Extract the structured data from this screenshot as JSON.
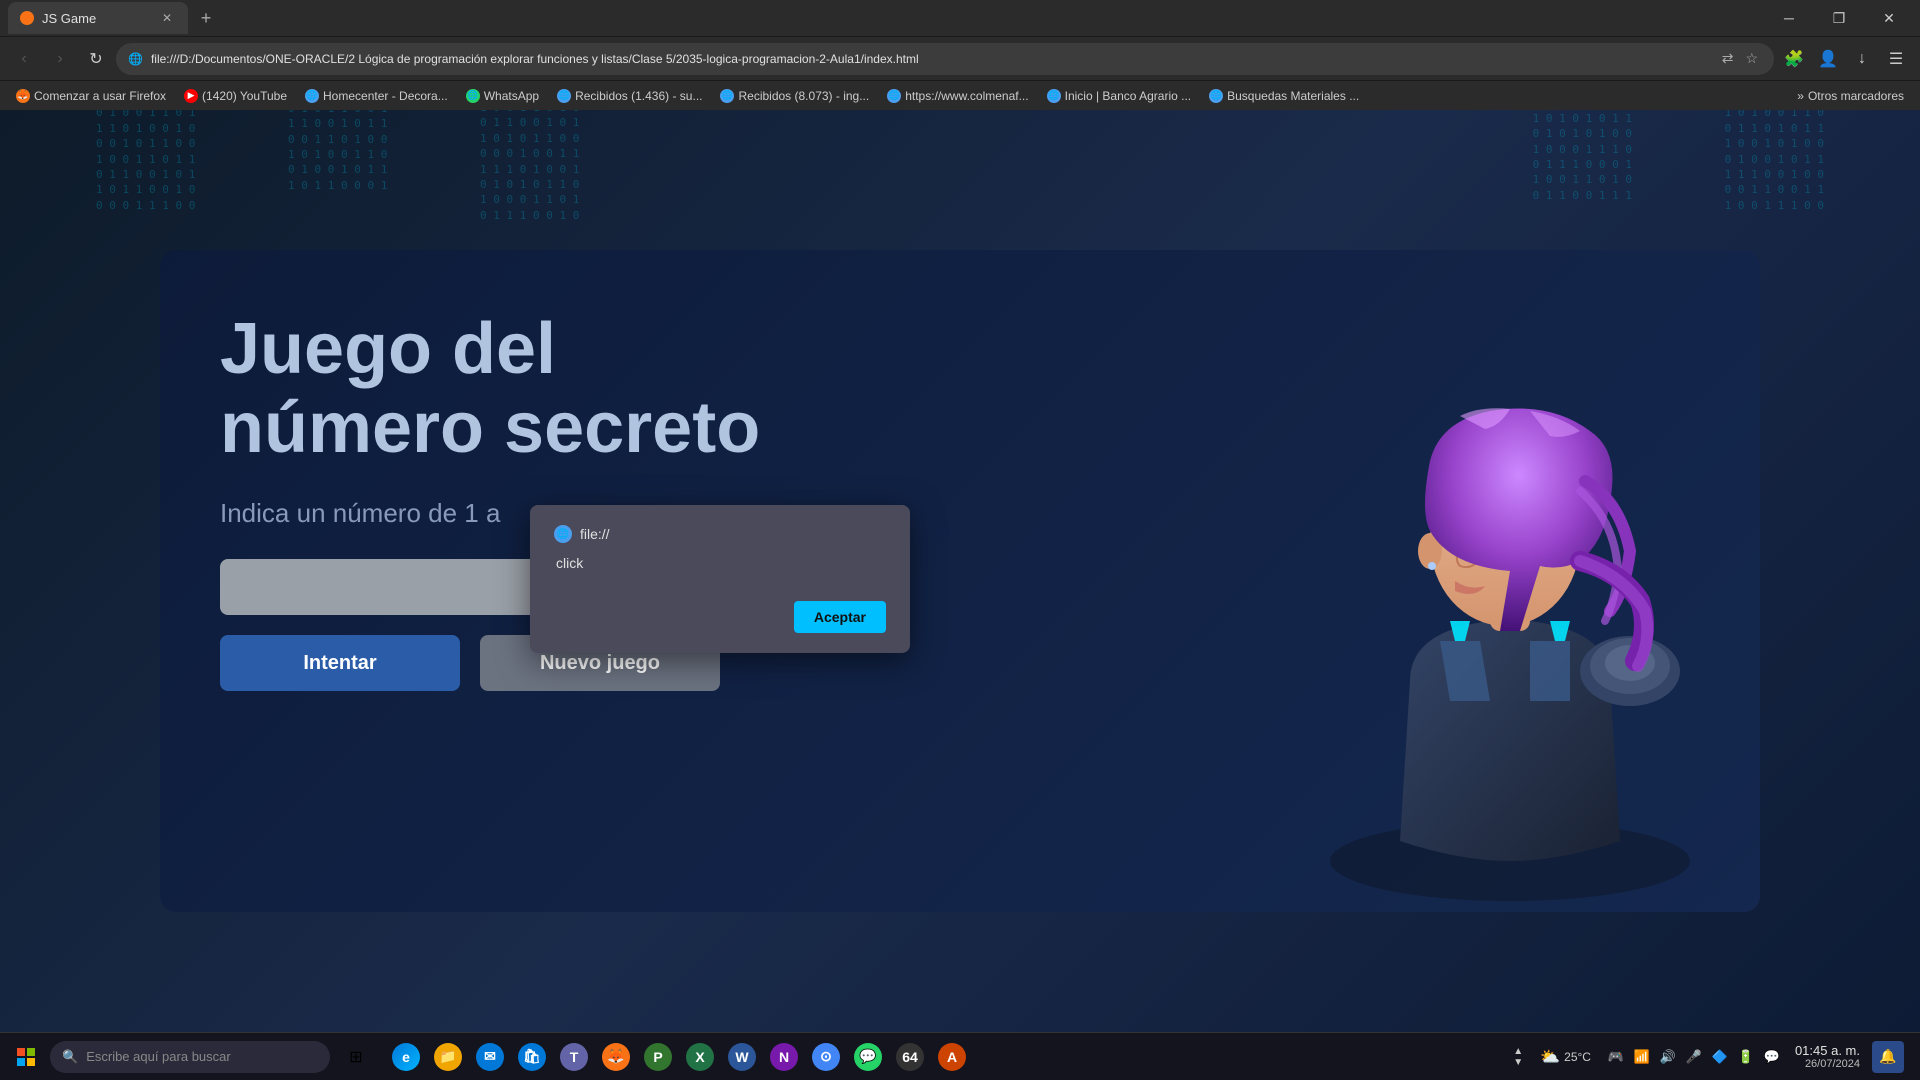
{
  "browser": {
    "tab": {
      "title": "JS Game",
      "favicon_color": "#f97316"
    },
    "address_bar": {
      "url": "file:///D:/Documentos/ONE-ORACLE/2 Lógica de programación explorar funciones y listas/Clase 5/2035-logica-programacion-2-Aula1/index.html"
    },
    "bookmarks": [
      {
        "label": "Comenzar a usar Firefox",
        "color": "#f97316"
      },
      {
        "label": "(1420) YouTube",
        "color": "#ff0000"
      },
      {
        "label": "Homecenter - Decora...",
        "color": "#4a9eed"
      },
      {
        "label": "WhatsApp",
        "color": "#25d366"
      },
      {
        "label": "Recibidos (1.436) - su...",
        "color": "#4a9eed"
      },
      {
        "label": "Recibidos (8.073) - ing...",
        "color": "#4a9eed"
      },
      {
        "label": "https://www.colmenaf...",
        "color": "#4a9eed"
      },
      {
        "label": "Inicio | Banco Agrario ...",
        "color": "#4a9eed"
      },
      {
        "label": "Busquedas Materiales ...",
        "color": "#4a9eed"
      }
    ],
    "bookmarks_more": "Otros marcadores"
  },
  "game": {
    "title_line1": "Juego del",
    "title_line2": "número secreto",
    "subtitle": "Indica un número de 1 a",
    "input_placeholder": "",
    "btn_try": "Intentar",
    "btn_new": "Nuevo juego"
  },
  "modal": {
    "file_url": "file://",
    "message": "click",
    "accept_btn": "Aceptar"
  },
  "taskbar": {
    "search_placeholder": "Escribe aquí para buscar",
    "clock_time": "01:45 a. m.",
    "clock_date": "26/07/2024",
    "weather_temp": "25°C"
  },
  "window_controls": {
    "minimize": "─",
    "maximize": "□",
    "close": "✕"
  }
}
